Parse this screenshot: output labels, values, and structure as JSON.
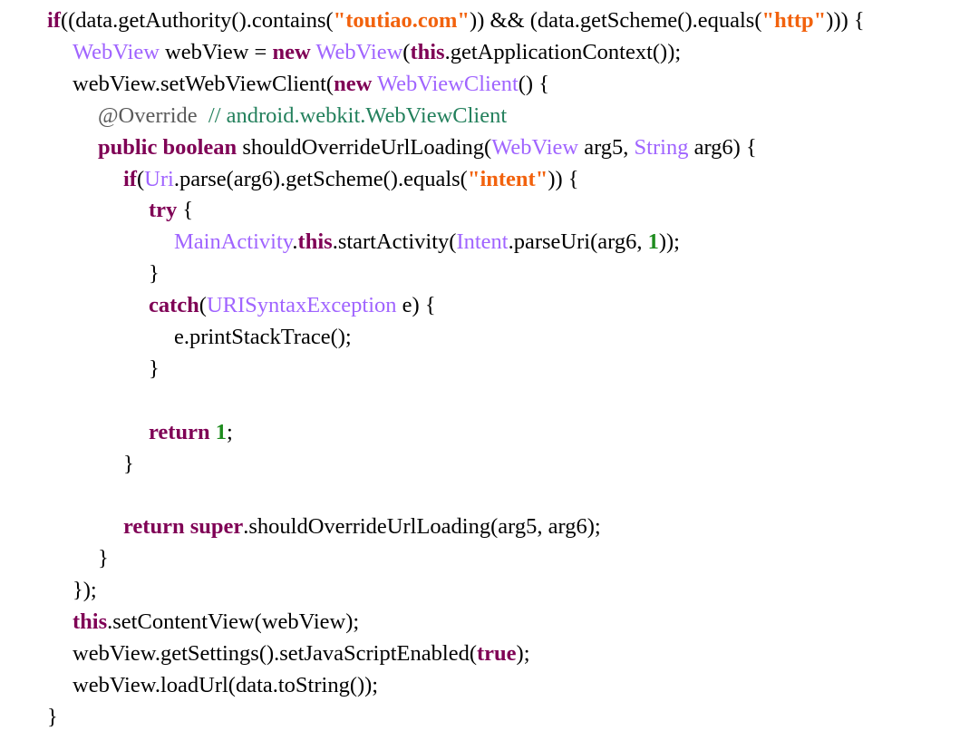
{
  "code_view": {
    "lines": [
      {
        "indent": 0,
        "tokens": [
          {
            "t": "kw",
            "v": "if"
          },
          {
            "t": "plain",
            "v": "((data.getAuthority().contains("
          },
          {
            "t": "str",
            "v": "\"toutiao.com\""
          },
          {
            "t": "plain",
            "v": ")) && (data.getScheme().equals("
          },
          {
            "t": "str",
            "v": "\"http\""
          },
          {
            "t": "plain",
            "v": "))) {"
          }
        ]
      },
      {
        "indent": 1,
        "tokens": [
          {
            "t": "type",
            "v": "WebView"
          },
          {
            "t": "plain",
            "v": " webView = "
          },
          {
            "t": "kw",
            "v": "new"
          },
          {
            "t": "plain",
            "v": " "
          },
          {
            "t": "type",
            "v": "WebView"
          },
          {
            "t": "plain",
            "v": "("
          },
          {
            "t": "kw",
            "v": "this"
          },
          {
            "t": "plain",
            "v": ".getApplicationContext());"
          }
        ]
      },
      {
        "indent": 1,
        "tokens": [
          {
            "t": "plain",
            "v": "webView.setWebViewClient("
          },
          {
            "t": "kw",
            "v": "new"
          },
          {
            "t": "plain",
            "v": " "
          },
          {
            "t": "type",
            "v": "WebViewClient"
          },
          {
            "t": "plain",
            "v": "() {"
          }
        ]
      },
      {
        "indent": 2,
        "tokens": [
          {
            "t": "anno",
            "v": "@Override"
          },
          {
            "t": "plain",
            "v": "  "
          },
          {
            "t": "comment",
            "v": "// android.webkit.WebViewClient"
          }
        ]
      },
      {
        "indent": 2,
        "tokens": [
          {
            "t": "kw",
            "v": "public"
          },
          {
            "t": "plain",
            "v": " "
          },
          {
            "t": "kw",
            "v": "boolean"
          },
          {
            "t": "plain",
            "v": " shouldOverrideUrlLoading("
          },
          {
            "t": "type",
            "v": "WebView"
          },
          {
            "t": "plain",
            "v": " arg5, "
          },
          {
            "t": "type",
            "v": "String"
          },
          {
            "t": "plain",
            "v": " arg6) {"
          }
        ]
      },
      {
        "indent": 3,
        "tokens": [
          {
            "t": "kw",
            "v": "if"
          },
          {
            "t": "plain",
            "v": "("
          },
          {
            "t": "type",
            "v": "Uri"
          },
          {
            "t": "plain",
            "v": ".parse(arg6).getScheme().equals("
          },
          {
            "t": "str",
            "v": "\"intent\""
          },
          {
            "t": "plain",
            "v": ")) {"
          }
        ]
      },
      {
        "indent": 4,
        "tokens": [
          {
            "t": "kw",
            "v": "try"
          },
          {
            "t": "plain",
            "v": " {"
          }
        ]
      },
      {
        "indent": 5,
        "tokens": [
          {
            "t": "type",
            "v": "MainActivity"
          },
          {
            "t": "plain",
            "v": "."
          },
          {
            "t": "kw",
            "v": "this"
          },
          {
            "t": "plain",
            "v": ".startActivity("
          },
          {
            "t": "type",
            "v": "Intent"
          },
          {
            "t": "plain",
            "v": ".parseUri(arg6, "
          },
          {
            "t": "num",
            "v": "1"
          },
          {
            "t": "plain",
            "v": "));"
          }
        ]
      },
      {
        "indent": 4,
        "tokens": [
          {
            "t": "plain",
            "v": "}"
          }
        ]
      },
      {
        "indent": 4,
        "tokens": [
          {
            "t": "kw",
            "v": "catch"
          },
          {
            "t": "plain",
            "v": "("
          },
          {
            "t": "type",
            "v": "URISyntaxException"
          },
          {
            "t": "plain",
            "v": " e) {"
          }
        ]
      },
      {
        "indent": 5,
        "tokens": [
          {
            "t": "plain",
            "v": "e.printStackTrace();"
          }
        ]
      },
      {
        "indent": 4,
        "tokens": [
          {
            "t": "plain",
            "v": "}"
          }
        ]
      },
      {
        "indent": 4,
        "tokens": []
      },
      {
        "indent": 4,
        "tokens": [
          {
            "t": "kw",
            "v": "return"
          },
          {
            "t": "plain",
            "v": " "
          },
          {
            "t": "num",
            "v": "1"
          },
          {
            "t": "plain",
            "v": ";"
          }
        ]
      },
      {
        "indent": 3,
        "tokens": [
          {
            "t": "plain",
            "v": "}"
          }
        ]
      },
      {
        "indent": 3,
        "tokens": []
      },
      {
        "indent": 3,
        "tokens": [
          {
            "t": "kw",
            "v": "return"
          },
          {
            "t": "plain",
            "v": " "
          },
          {
            "t": "kw",
            "v": "super"
          },
          {
            "t": "plain",
            "v": ".shouldOverrideUrlLoading(arg5, arg6);"
          }
        ]
      },
      {
        "indent": 2,
        "tokens": [
          {
            "t": "plain",
            "v": "}"
          }
        ]
      },
      {
        "indent": 1,
        "tokens": [
          {
            "t": "plain",
            "v": "});"
          }
        ]
      },
      {
        "indent": 1,
        "tokens": [
          {
            "t": "kw",
            "v": "this"
          },
          {
            "t": "plain",
            "v": ".setContentView(webView);"
          }
        ]
      },
      {
        "indent": 1,
        "tokens": [
          {
            "t": "plain",
            "v": "webView.getSettings().setJavaScriptEnabled("
          },
          {
            "t": "kw",
            "v": "true"
          },
          {
            "t": "plain",
            "v": ");"
          }
        ]
      },
      {
        "indent": 1,
        "tokens": [
          {
            "t": "plain",
            "v": "webView.loadUrl(data.toString());"
          }
        ]
      },
      {
        "indent": 0,
        "tokens": [
          {
            "t": "plain",
            "v": "}"
          }
        ]
      }
    ]
  }
}
